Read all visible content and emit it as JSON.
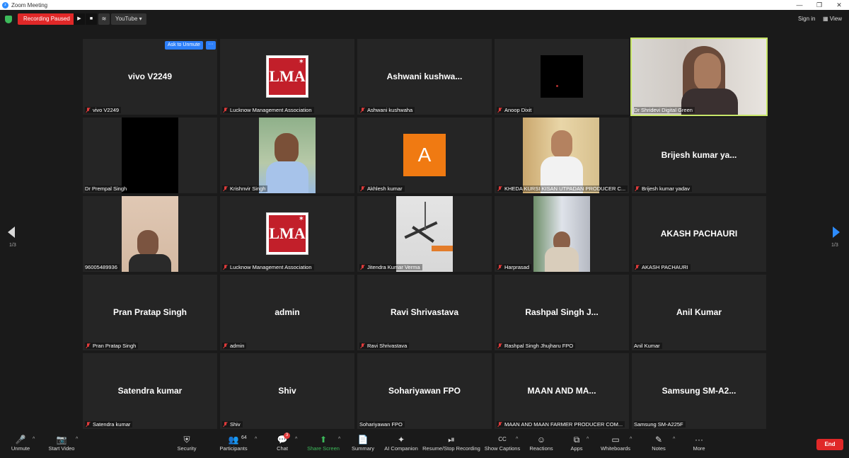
{
  "window": {
    "title": "Zoom Meeting",
    "minimize": "—",
    "restore": "❐",
    "close": "✕"
  },
  "topbar": {
    "recording_status": "Recording Paused",
    "play": "▶",
    "stop": "■",
    "live_icon": "≋",
    "stream_target": "YouTube ▾",
    "sign_in": "Sign in",
    "view": "View"
  },
  "ask_to_unmute": {
    "label": "Ask to Unmute",
    "more": "···"
  },
  "tiles": [
    {
      "display": "vivo V2249",
      "label": "vivo V2249",
      "muted": true
    },
    {
      "display": "",
      "label": "Lucknow Management Association",
      "muted": true
    },
    {
      "display": "Ashwani  kushwa...",
      "label": "Ashwani kushwaha",
      "muted": true
    },
    {
      "display": "",
      "label": "Anoop Dixit",
      "muted": true
    },
    {
      "display": "",
      "label": "Dr Shridevi Digital Green",
      "muted": false
    },
    {
      "display": "",
      "label": "Dr Prempal Singh",
      "muted": false
    },
    {
      "display": "",
      "label": "Krishnvir Singh",
      "muted": true
    },
    {
      "display": "A",
      "label": "Akhlesh kumar",
      "muted": true
    },
    {
      "display": "",
      "label": "KHEDA KURSI KISAN UTPADAN PRODUCER C...",
      "muted": true
    },
    {
      "display": "Brijesh kumar ya...",
      "label": "Brijesh kumar yadav",
      "muted": true
    },
    {
      "display": "",
      "label": "96005489936",
      "muted": false
    },
    {
      "display": "",
      "label": "Lucknow Management Association",
      "muted": true
    },
    {
      "display": "",
      "label": "Jitendra Kumar Verma",
      "muted": true
    },
    {
      "display": "",
      "label": "Harprasad",
      "muted": true
    },
    {
      "display": "AKASH PACHAURI",
      "label": "AKASH PACHAURI",
      "muted": true
    },
    {
      "display": "Pran Pratap Singh",
      "label": "Pran Pratap Singh",
      "muted": true
    },
    {
      "display": "admin",
      "label": "admin",
      "muted": true
    },
    {
      "display": "Ravi Shrivastava",
      "label": "Ravi Shrivastava",
      "muted": true
    },
    {
      "display": "Rashpal Singh J...",
      "label": "Rashpal Singh Jhujharu FPO",
      "muted": true
    },
    {
      "display": "Anil Kumar",
      "label": "Anil Kumar",
      "muted": false
    },
    {
      "display": "Satendra kumar",
      "label": "Satendra kumar",
      "muted": true
    },
    {
      "display": "Shiv",
      "label": "Shiv",
      "muted": true
    },
    {
      "display": "Sohariyawan FPO",
      "label": "Sohariyawan FPO",
      "muted": false
    },
    {
      "display": "MAAN  AND  MA...",
      "label": "MAAN AND MAAN FARMER PRODUCER COM...",
      "muted": true
    },
    {
      "display": "Samsung  SM-A2...",
      "label": "Samsung SM-A225F",
      "muted": false
    }
  ],
  "lma_logo": {
    "text": "LMA",
    "star": "✶"
  },
  "pagination": {
    "page": "1/3"
  },
  "toolbar": {
    "unmute": "Unmute",
    "start_video": "Start Video",
    "security": "Security",
    "participants": "Participants",
    "participants_count": "64",
    "chat": "Chat",
    "chat_badge": "3",
    "share_screen": "Share Screen",
    "summary": "Summary",
    "ai_companion": "AI Companion",
    "recording": "Resume/Stop Recording",
    "captions": "Show Captions",
    "reactions": "Reactions",
    "apps": "Apps",
    "whiteboards": "Whiteboards",
    "notes": "Notes",
    "more": "More",
    "end": "End"
  },
  "icons": {
    "unmute": "🎤",
    "video": "📷",
    "security": "⛨",
    "participants": "👥",
    "chat": "💬",
    "share": "⬆",
    "summary": "📄",
    "ai": "✦",
    "record": "⏯",
    "captions": "CC",
    "reactions": "☺",
    "apps": "⧉",
    "whiteboards": "▭",
    "notes": "✎",
    "more": "···",
    "chevron": "^"
  },
  "colors": {
    "accent": "#2d8cff",
    "danger": "#e02828",
    "active_speaker": "#c8e66a",
    "success": "#3dbb5b"
  }
}
